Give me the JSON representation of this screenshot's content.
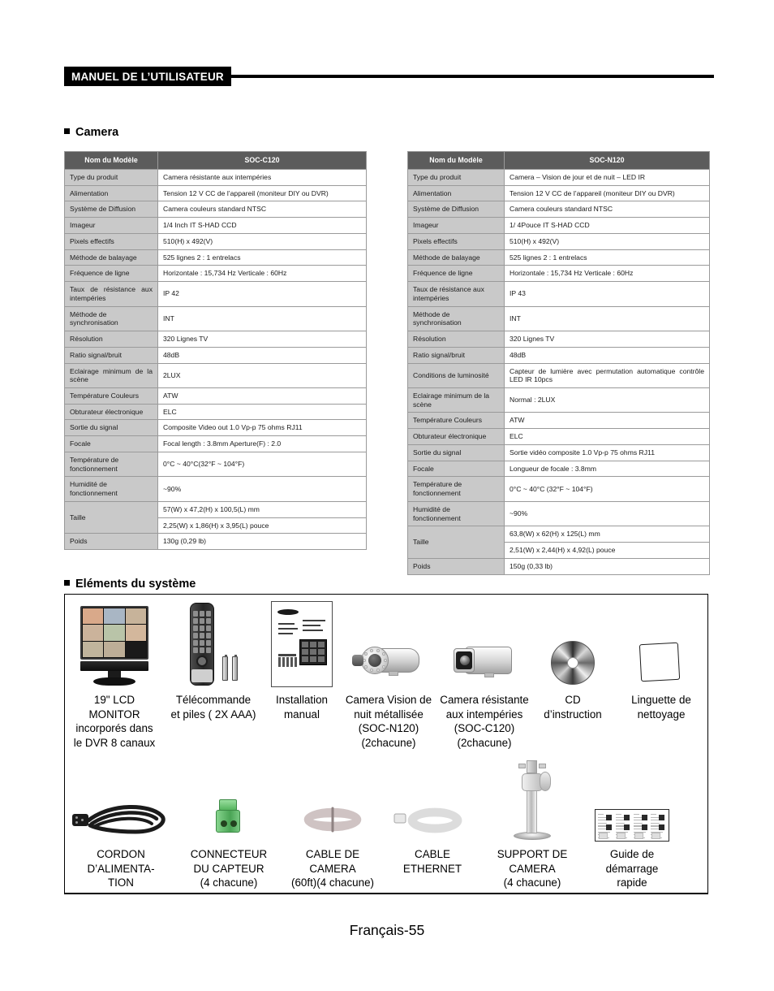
{
  "header": {
    "title": "MANUEL DE L’UTILISATEUR"
  },
  "sections": {
    "camera_heading": "Camera",
    "system_heading": "Eléments du système"
  },
  "tables": [
    {
      "id": "soc-c120",
      "header": {
        "label": "Nom du Modèle",
        "value": "SOC-C120"
      },
      "rows": [
        {
          "label": "Type du produit",
          "value": "Camera résistante aux intempéries"
        },
        {
          "label": "Alimentation",
          "value": "Tension 12 V CC de l’appareil (moniteur DIY ou DVR)"
        },
        {
          "label": "Système de Diffusion",
          "value": "Camera couleurs standard NTSC"
        },
        {
          "label": "Imageur",
          "value": "1/4 Inch IT S-HAD CCD"
        },
        {
          "label": "Pixels effectifs",
          "value": "510(H) x 492(V)"
        },
        {
          "label": "Méthode de balayage",
          "value": "525 lignes 2 : 1 entrelacs"
        },
        {
          "label": "Fréquence de ligne",
          "value": "Horizontale  : 15,734 Hz Verticale : 60Hz"
        },
        {
          "label": "Taux de résistance aux intempéries",
          "value": "IP 42",
          "label_justify": true
        },
        {
          "label": "Méthode de synchronisation",
          "value": "INT"
        },
        {
          "label": "Résolution",
          "value": "320 Lignes TV"
        },
        {
          "label": "Ratio signal/bruit",
          "value": "48dB"
        },
        {
          "label": "Eclairage minimum de la scène",
          "value": "2LUX",
          "label_justify": true
        },
        {
          "label": "Température Couleurs",
          "value": "ATW"
        },
        {
          "label": "Obturateur électronique",
          "value": "ELC"
        },
        {
          "label": "Sortie du signal",
          "value": "Composite Video out 1.0 Vp-p 75 ohms RJ11"
        },
        {
          "label": "Focale",
          "value": "Focal length : 3.8mm        Aperture(F) : 2.0"
        },
        {
          "label": "Température de fonctionnement",
          "value": "0°C ~ 40°C(32°F ~ 104°F)"
        },
        {
          "label": "Humidité de fonctionnement",
          "value": "~90%"
        },
        {
          "label": "Taille",
          "value": "57(W) x 47,2(H) x 100,5(L) mm",
          "value2": "2,25(W) x 1,86(H) x 3,95(L) pouce"
        },
        {
          "label": "Poids",
          "value": "130g (0,29 lb)"
        }
      ]
    },
    {
      "id": "soc-n120",
      "header": {
        "label": "Nom du Modèle",
        "value": "SOC-N120"
      },
      "rows": [
        {
          "label": "Type du produit",
          "value": "Camera – Vision de jour et de nuit – LED IR"
        },
        {
          "label": "Alimentation",
          "value": "Tension 12 V CC de l’appareil (moniteur DIY ou DVR)"
        },
        {
          "label": "Système de Diffusion",
          "value": "Camera couleurs standard NTSC"
        },
        {
          "label": "Imageur",
          "value": "1/ 4Pouce IT S-HAD CCD"
        },
        {
          "label": "Pixels effectifs",
          "value": "510(H) x 492(V)"
        },
        {
          "label": "Méthode de balayage",
          "value": "525 lignes 2 : 1 entrelacs"
        },
        {
          "label": "Fréquence de ligne",
          "value": "Horizontale  : 15,734 Hz Verticale : 60Hz"
        },
        {
          "label": "Taux de résistance aux intempéries",
          "value": "IP 43"
        },
        {
          "label": "Méthode de synchronisation",
          "value": "INT"
        },
        {
          "label": "Résolution",
          "value": "320 Lignes TV"
        },
        {
          "label": "Ratio signal/bruit",
          "value": "48dB"
        },
        {
          "label": "Conditions de luminosité",
          "value": "Capteur de lumière avec permutation automatique contrôle LED IR 10pcs",
          "value_justify": true
        },
        {
          "label": "Eclairage minimum de la scène",
          "value": "Normal : 2LUX"
        },
        {
          "label": "Température Couleurs",
          "value": "ATW"
        },
        {
          "label": "Obturateur électronique",
          "value": "ELC"
        },
        {
          "label": "Sortie du signal",
          "value": "Sortie vidéo composite 1.0 Vp-p 75 ohms RJ11"
        },
        {
          "label": "Focale",
          "value": "Longueur de focale : 3.8mm"
        },
        {
          "label": "Température de fonctionnement",
          "value": "0°C ~ 40°C (32°F ~ 104°F)"
        },
        {
          "label": "Humidité de fonctionnement",
          "value": "~90%"
        },
        {
          "label": "Taille",
          "value": "63,8(W) x 62(H) x 125(L) mm",
          "value2": "2,51(W) x 2,44(H) x 4,92(L) pouce"
        },
        {
          "label": "Poids",
          "value": "150g (0,33 lb)"
        }
      ]
    }
  ],
  "system_items": {
    "row1": [
      {
        "icon": "lcd-monitor-icon",
        "caption": "19\" LCD\nMONITOR\nincorporés dans\nle DVR 8 canaux"
      },
      {
        "icon": "remote-control-icon",
        "caption": "Télécommande\net piles ( 2X AAA)"
      },
      {
        "icon": "installation-manual-icon",
        "caption": "Installation\nmanual"
      },
      {
        "icon": "night-vision-camera-icon",
        "caption": "Camera Vision de\nnuit métallisée\n(SOC-N120)\n(2chacune)"
      },
      {
        "icon": "weatherproof-camera-icon",
        "caption": "Camera résistante\naux intempéries\n(SOC-C120)\n(2chacune)"
      },
      {
        "icon": "cd-disc-icon",
        "caption": "CD\nd’instruction"
      },
      {
        "icon": "cleaning-cloth-icon",
        "caption": "Linguette de\nnettoyage"
      }
    ],
    "row2": [
      {
        "icon": "power-cord-icon",
        "caption": "CORDON\nD’ALIMENTA-\nTION"
      },
      {
        "icon": "sensor-connector-icon",
        "caption": "CONNECTEUR\nDU CAPTEUR\n(4 chacune)"
      },
      {
        "icon": "camera-cable-icon",
        "caption": "CABLE DE\nCAMERA\n(60ft)(4 chacune)"
      },
      {
        "icon": "ethernet-cable-icon",
        "caption": "CABLE\nETHERNET"
      },
      {
        "icon": "camera-mount-icon",
        "caption": "SUPPORT DE\nCAMERA\n(4 chacune)"
      },
      {
        "icon": "quick-start-guide-icon",
        "caption": "Guide de\ndémarrage\nrapide"
      }
    ]
  },
  "footer": {
    "page_label": "Français-55"
  },
  "colors": {
    "table_header_bg": "#5c5c5c",
    "table_label_bg": "#c9c9c9",
    "rule": "#000000",
    "connector_green": "#55b45e"
  }
}
